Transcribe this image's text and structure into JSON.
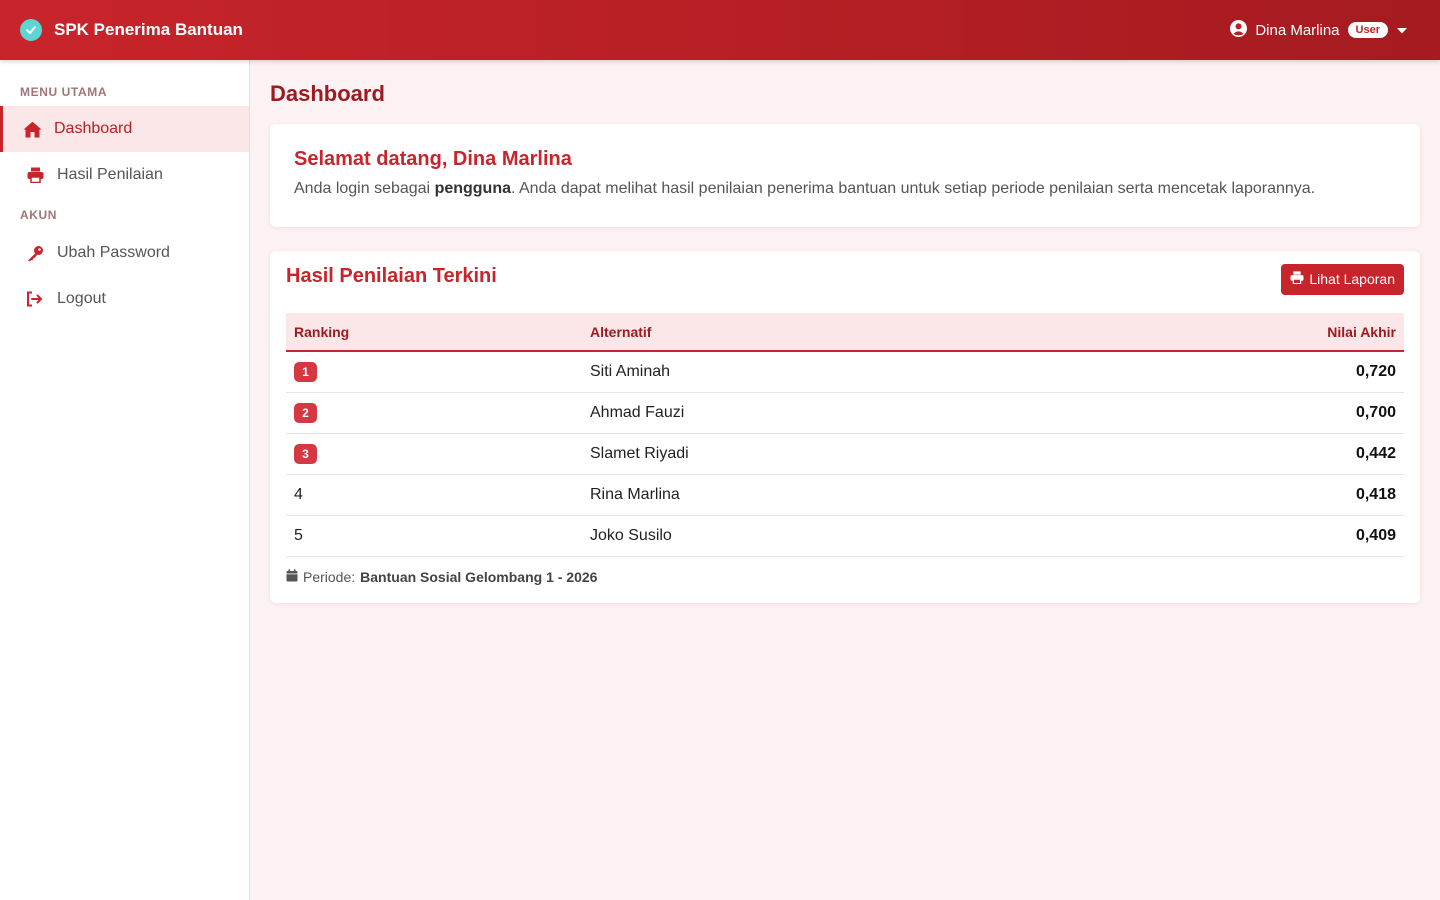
{
  "app": {
    "brand": "SPK Penerima Bantuan"
  },
  "user": {
    "name": "Dina Marlina",
    "role": "User"
  },
  "sidebar": {
    "sections": [
      {
        "title": "MENU UTAMA",
        "items": [
          {
            "label": "Dashboard",
            "icon": "home-icon",
            "active": true
          },
          {
            "label": "Hasil Penilaian",
            "icon": "printer-icon",
            "active": false
          }
        ]
      },
      {
        "title": "AKUN",
        "items": [
          {
            "label": "Ubah Password",
            "icon": "key-icon",
            "active": false
          },
          {
            "label": "Logout",
            "icon": "logout-icon",
            "active": false
          }
        ]
      }
    ]
  },
  "page": {
    "title": "Dashboard"
  },
  "welcome": {
    "title": "Selamat datang, Dina Marlina",
    "text_before": "Anda login sebagai ",
    "role_bold": "pengguna",
    "text_after": ". Anda dapat melihat hasil penilaian penerima bantuan untuk setiap periode penilaian serta mencetak laporannya."
  },
  "results": {
    "title": "Hasil Penilaian Terkini",
    "report_button": "Lihat Laporan",
    "columns": [
      "Ranking",
      "Alternatif",
      "Nilai Akhir"
    ],
    "rows": [
      {
        "rank": "1",
        "name": "Siti Aminah",
        "score": "0,720",
        "badge": true
      },
      {
        "rank": "2",
        "name": "Ahmad Fauzi",
        "score": "0,700",
        "badge": true
      },
      {
        "rank": "3",
        "name": "Slamet Riyadi",
        "score": "0,442",
        "badge": true
      },
      {
        "rank": "4",
        "name": "Rina Marlina",
        "score": "0,418",
        "badge": false
      },
      {
        "rank": "5",
        "name": "Joko Susilo",
        "score": "0,409",
        "badge": false
      }
    ],
    "periode_label": "Periode:",
    "periode_value": "Bantuan Sosial Gelombang 1 - 2026"
  },
  "colors": {
    "primary": "#c8242b",
    "primary_dark": "#9c1b21",
    "accent_icon": "#5dd5d3",
    "background": "#fdf2f3"
  }
}
